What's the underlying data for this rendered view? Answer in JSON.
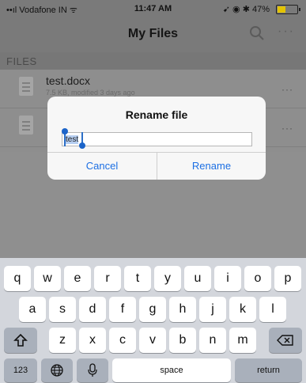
{
  "status_bar": {
    "carrier": "••ıl Vodafone IN ᯤ",
    "time": "11:47 AM",
    "battery_text": "➹ ◉ ✱ 47%",
    "battery_level": 0.47,
    "battery_color": "#e3c300"
  },
  "nav": {
    "title": "My Files",
    "search_icon": "search-icon",
    "more_icon": "more-icon",
    "more_glyph": "···"
  },
  "section": {
    "label": "FILES"
  },
  "files": [
    {
      "name": "test.docx",
      "meta": "7.5 KB, modified 3 days ago",
      "icon": "document-icon",
      "more": "···"
    },
    {
      "name": "",
      "meta": "",
      "icon": "document-icon",
      "more": "···"
    }
  ],
  "dialog": {
    "title": "Rename file",
    "input_value": "test",
    "cancel_label": "Cancel",
    "rename_label": "Rename",
    "accent_color": "#1c6fe3"
  },
  "keyboard": {
    "row1": [
      "q",
      "w",
      "e",
      "r",
      "t",
      "y",
      "u",
      "i",
      "o",
      "p"
    ],
    "row2": [
      "a",
      "s",
      "d",
      "f",
      "g",
      "h",
      "j",
      "k",
      "l"
    ],
    "row3": [
      "z",
      "x",
      "c",
      "v",
      "b",
      "n",
      "m"
    ],
    "shift_icon": "shift-icon",
    "backspace_icon": "backspace-icon",
    "numbers_label": "123",
    "globe_icon": "globe-icon",
    "mic_icon": "microphone-icon",
    "space_label": "space",
    "return_label": "return"
  }
}
